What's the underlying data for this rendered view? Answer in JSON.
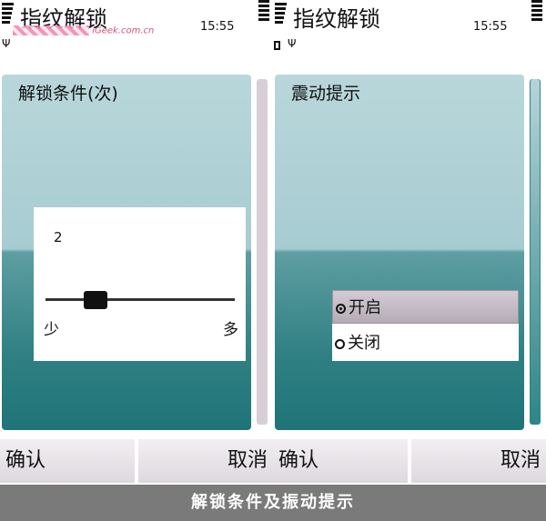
{
  "screens": [
    {
      "title": "指纹解锁",
      "clock": "15:55",
      "panel_title": "解锁条件(次)",
      "slider": {
        "value": "2",
        "value_fraction": 0.2,
        "min_label": "少",
        "max_label": "多"
      },
      "softkeys": {
        "left": "确认",
        "right": "取消"
      }
    },
    {
      "title": "指纹解锁",
      "clock": "15:55",
      "panel_title": "震动提示",
      "options": [
        {
          "label": "开启",
          "selected": true
        },
        {
          "label": "关闭",
          "selected": false
        }
      ],
      "softkeys": {
        "left": "确认",
        "right": "取消"
      }
    }
  ],
  "watermark": "iGeek.com.cn",
  "caption": "解锁条件及振动提示",
  "icons": {
    "signal": "signal-strength-icon",
    "battery": "battery-level-icon",
    "antenna": "antenna-icon",
    "battery_small": "battery-icon"
  },
  "colors": {
    "panel_top": "#b9d7db",
    "panel_bottom": "#1f7477",
    "caption_bg": "#7a7a7a"
  }
}
